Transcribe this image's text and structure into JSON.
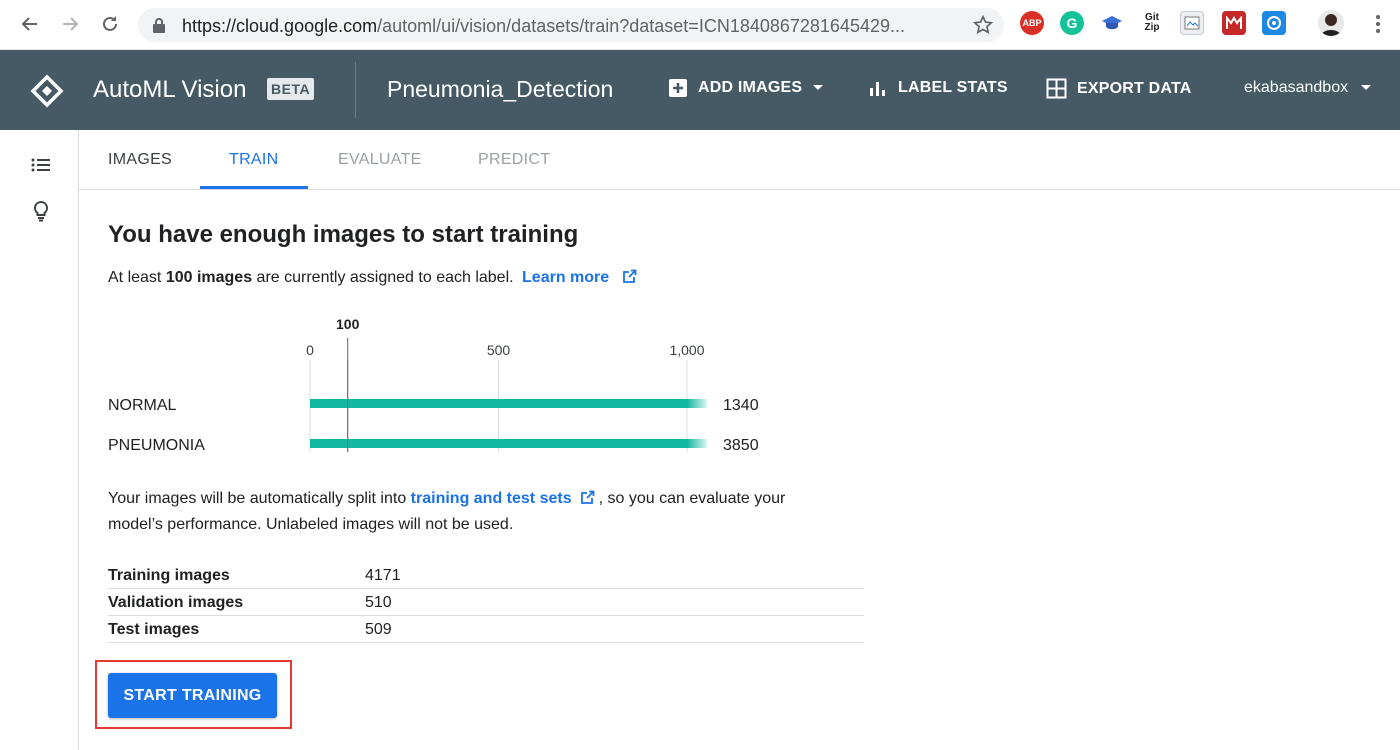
{
  "browser": {
    "url_main": "https://cloud.google.com",
    "url_rest": "/automl/ui/vision/datasets/train?dataset=ICN1840867281645429...",
    "extensions": [
      "ABP",
      "G",
      "Git Zip"
    ]
  },
  "appbar": {
    "product": "AutoML Vision",
    "beta": "BETA",
    "dataset": "Pneumonia_Detection",
    "add_images": "ADD IMAGES",
    "label_stats": "LABEL STATS",
    "export_data": "EXPORT DATA",
    "account": "ekabasandbox"
  },
  "tabs": {
    "images": "IMAGES",
    "train": "TRAIN",
    "evaluate": "EVALUATE",
    "predict": "PREDICT"
  },
  "main": {
    "heading": "You have enough images to start training",
    "sub_prefix": "At least ",
    "sub_bold": "100 images",
    "sub_suffix": " are currently assigned to each label.",
    "learn_more": "Learn more",
    "para_prefix": "Your images will be automatically split into ",
    "para_link": "training and test sets",
    "para_suffix": ", so you can evaluate your model’s performance. Unlabeled images will not be used.",
    "start_training": "START TRAINING"
  },
  "stats": [
    {
      "label": "Training images",
      "value": "4171"
    },
    {
      "label": "Validation images",
      "value": "510"
    },
    {
      "label": "Test images",
      "value": "509"
    }
  ],
  "chart_data": {
    "type": "bar",
    "orientation": "horizontal",
    "categories": [
      "NORMAL",
      "PNEUMONIA"
    ],
    "values": [
      1340,
      3850
    ],
    "value_labels": [
      "1340",
      "3850"
    ],
    "xticks": [
      0,
      500,
      1000
    ],
    "xtick_labels": [
      "0",
      "500",
      "1,000"
    ],
    "xlim": [
      0,
      1000
    ],
    "threshold": 100,
    "threshold_label": "100",
    "bar_color": "#14b79f",
    "grid": true
  },
  "colors": {
    "appbar": "#465a65",
    "accent": "#1a73e8",
    "bar": "#14b79f",
    "highlight": "#e53935"
  }
}
